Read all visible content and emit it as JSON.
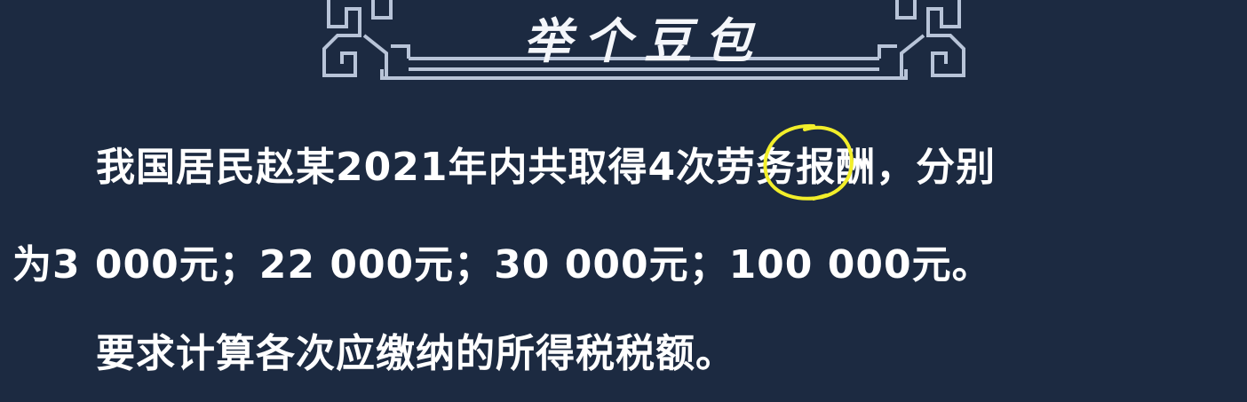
{
  "slide": {
    "title": "举个豆包",
    "paragraph_1": "我国居民赵某2021年内共取得4次劳务报酬，分别",
    "paragraph_2": "为3 000元；22 000元；30 000元；100 000元。",
    "paragraph_3": "要求计算各次应缴纳的所得税税额。"
  },
  "colors": {
    "background": "#1c2a41",
    "frame": "#b8c4d8",
    "text": "#ffffff",
    "annotation": "#f2ee2a"
  }
}
